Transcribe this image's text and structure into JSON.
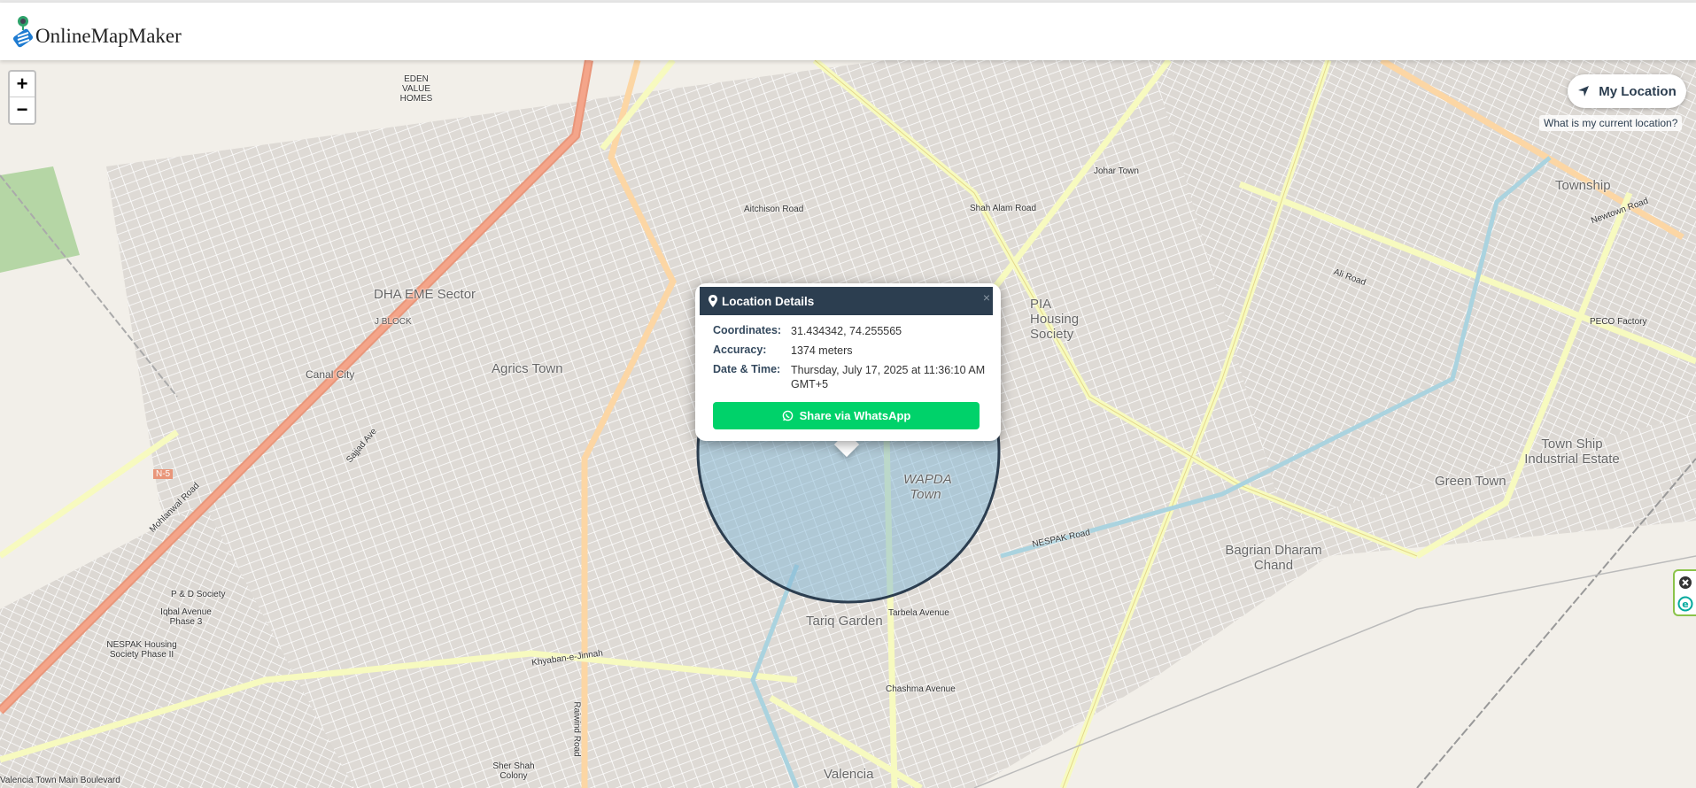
{
  "header": {
    "logo_text": "OnlineMapMaker"
  },
  "zoom": {
    "in": "+",
    "out": "−"
  },
  "my_location": {
    "label": "My Location",
    "caption": "What is my current location?"
  },
  "popup": {
    "title": "Location Details",
    "close": "×",
    "coordinates_label": "Coordinates:",
    "coordinates": "31.434342, 74.255565",
    "accuracy_label": "Accuracy:",
    "accuracy": "1374 meters",
    "datetime_label": "Date & Time:",
    "datetime": "Thursday, July 17, 2025 at 11:36:10 AM GMT+5",
    "share_label": "Share via WhatsApp"
  },
  "map_labels": {
    "dha": "DHA EME Sector",
    "agrics": "Agrics Town",
    "pia": "PIA Housing Society",
    "wapda": "WAPDA Town",
    "tariq": "Tariq Garden",
    "township": "Township",
    "green": "Green Town",
    "bagrian": "Bagrian Dharam Chand",
    "industrial": "Town Ship Industrial Estate",
    "canal": "Canal City",
    "jblock": "J BLOCK",
    "valencia": "Valencia",
    "khyaban": "Khyaban-e-Jinnah",
    "raiwind": "Raiwind Road",
    "mohlanwal": "Mohlanwal Road",
    "aitchison": "Aitchison Road",
    "shahalam": "Shah Alam Road",
    "nespak": "NESPAK Road",
    "tarbela": "Tarbela Avenue",
    "chashma": "Chashma Avenue",
    "ali": "Ali Road",
    "peco": "PECO Factory",
    "newtown": "Newtown Road",
    "johar": "Johar Town",
    "n5": "N-5",
    "sajjad": "Sajjad Ave",
    "valencia_blvd": "Valencia Town Main Boulevard",
    "pd": "P & D Society",
    "iqbal": "Iqbal Avenue Phase 3",
    "nespak_soc": "NESPAK Housing Society Phase II",
    "shershah": "Sher Shah Colony",
    "eden": "EDEN VALUE HOMES"
  },
  "colors": {
    "header_dark": "#2c3e50",
    "whatsapp": "#00d26a",
    "accuracy_fill": "#7fb6d6",
    "map_bg": "#f2efe9"
  }
}
